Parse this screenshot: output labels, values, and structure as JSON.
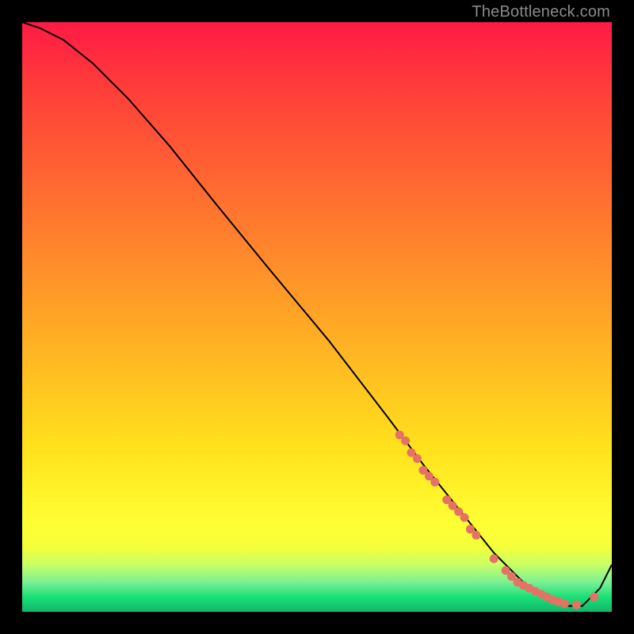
{
  "watermark": "TheBottleneck.com",
  "colors": {
    "gradient_top": "#ff1a46",
    "gradient_mid": "#ffe11c",
    "gradient_bottom": "#14b56c",
    "curve": "#000000",
    "marker": "#e47265",
    "frame": "#000000"
  },
  "chart_data": {
    "type": "line",
    "title": "",
    "xlabel": "",
    "ylabel": "",
    "xlim": [
      0,
      100
    ],
    "ylim": [
      0,
      100
    ],
    "curve": {
      "x": [
        0,
        3,
        7,
        12,
        18,
        25,
        33,
        42,
        52,
        62,
        68,
        72,
        76,
        80,
        83,
        86,
        89,
        92,
        95,
        98,
        100
      ],
      "y": [
        100,
        99,
        97,
        93,
        87,
        79,
        69,
        58,
        46,
        33,
        25,
        20,
        15,
        10,
        7,
        4,
        2,
        1,
        1,
        4,
        8
      ]
    },
    "markers": [
      {
        "x": 64,
        "y": 30
      },
      {
        "x": 65,
        "y": 29
      },
      {
        "x": 66,
        "y": 27
      },
      {
        "x": 67,
        "y": 26
      },
      {
        "x": 68,
        "y": 24
      },
      {
        "x": 69,
        "y": 23
      },
      {
        "x": 70,
        "y": 22
      },
      {
        "x": 72,
        "y": 19
      },
      {
        "x": 73,
        "y": 18
      },
      {
        "x": 74,
        "y": 17
      },
      {
        "x": 75,
        "y": 16
      },
      {
        "x": 76,
        "y": 14
      },
      {
        "x": 77,
        "y": 13
      },
      {
        "x": 80,
        "y": 9
      },
      {
        "x": 82,
        "y": 7
      },
      {
        "x": 83,
        "y": 6
      },
      {
        "x": 84,
        "y": 5
      },
      {
        "x": 85,
        "y": 4.5
      },
      {
        "x": 86,
        "y": 4
      },
      {
        "x": 87,
        "y": 3.5
      },
      {
        "x": 88,
        "y": 3
      },
      {
        "x": 89,
        "y": 2.5
      },
      {
        "x": 90,
        "y": 2
      },
      {
        "x": 91,
        "y": 1.7
      },
      {
        "x": 92,
        "y": 1.4
      },
      {
        "x": 94,
        "y": 1.2
      },
      {
        "x": 97,
        "y": 2.5
      }
    ]
  }
}
